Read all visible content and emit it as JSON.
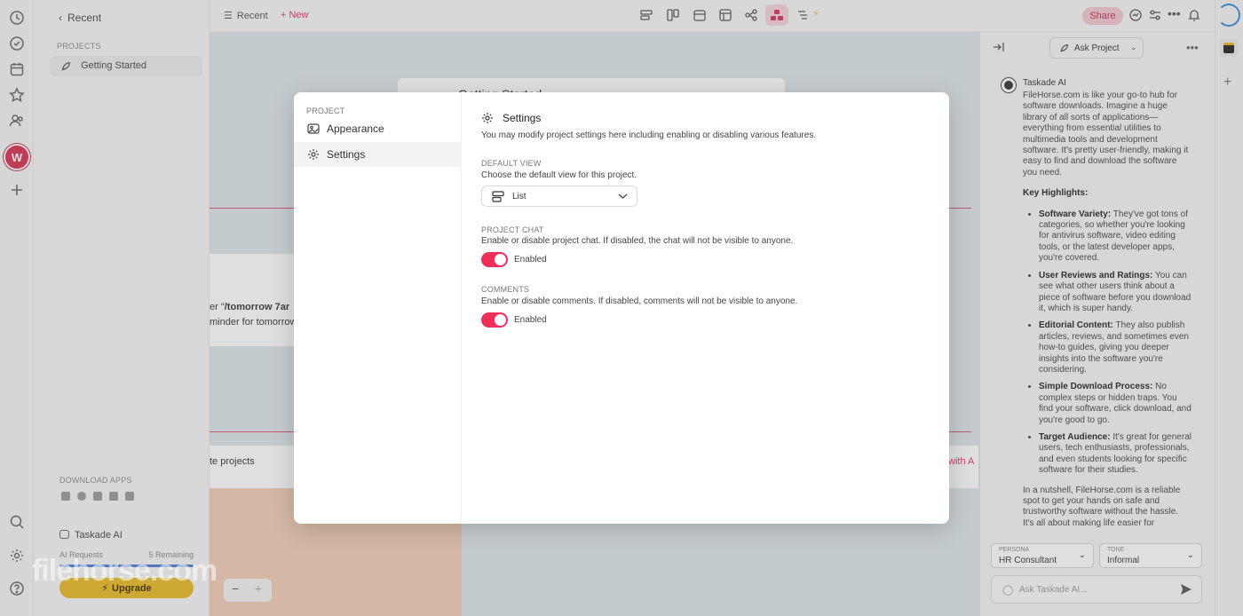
{
  "sidebar": {
    "back_label": "Recent",
    "projects_caption": "PROJECTS",
    "project_item": "Getting Started",
    "download_caption": "DOWNLOAD APPS",
    "ai_label": "Taskade AI",
    "ai_requests_label": "AI Requests",
    "ai_remaining": "5 Remaining",
    "ai_requests_fraction": 1.0,
    "upgrade_label": "Upgrade",
    "workspace_initial": "W"
  },
  "toolbar": {
    "recent_label": "Recent",
    "new_label": "New",
    "share_label": "Share"
  },
  "canvas": {
    "title_fragment": "Getting Started",
    "text_line1_prefix": "er \"",
    "text_line1_bold": "/tomorrow 7ar",
    "text_line2": "minder for tomorrow",
    "row_text": "te projects",
    "row_right_text": "with A"
  },
  "ai_panel": {
    "mode_label": "Ask Project",
    "assistant_name": "Taskade AI",
    "intro": "FileHorse.com is like your go-to hub for software downloads. Imagine a huge library of all sorts of applications—everything from essential utilities to multimedia tools and development software. It's pretty user-friendly, making it easy to find and download the software you need.",
    "highlights_title": "Key Highlights:",
    "highlights": [
      {
        "title": "Software Variety:",
        "text": "They've got tons of categories, so whether you're looking for antivirus software, video editing tools, or the latest developer apps, you're covered."
      },
      {
        "title": "User Reviews and Ratings:",
        "text": "You can see what other users think about a piece of software before you download it, which is super handy."
      },
      {
        "title": "Editorial Content:",
        "text": "They also publish articles, reviews, and sometimes even how-to guides, giving you deeper insights into the software you're considering."
      },
      {
        "title": "Simple Download Process:",
        "text": "No complex steps or hidden traps. You find your software, click download, and you're good to go."
      },
      {
        "title": "Target Audience:",
        "text": "It's great for general users, tech enthusiasts, professionals, and even students looking for specific software for their studies."
      }
    ],
    "conclusion": "In a nutshell, FileHorse.com is a reliable spot to get your hands on safe and trustworthy software without the hassle. It's all about making life easier for",
    "persona_caption": "PERSONA",
    "persona_value": "HR Consultant",
    "tone_caption": "TONE",
    "tone_value": "Informal",
    "ask_placeholder": "Ask Taskade AI..."
  },
  "modal": {
    "nav_caption": "PROJECT",
    "nav_items": [
      "Appearance",
      "Settings"
    ],
    "title": "Settings",
    "description": "You may modify project settings here including enabling or disabling various features.",
    "default_view": {
      "caption": "DEFAULT VIEW",
      "description": "Choose the default view for this project.",
      "value": "List"
    },
    "project_chat": {
      "caption": "PROJECT CHAT",
      "description": "Enable or disable project chat. If disabled, the chat will not be visible to anyone.",
      "state": "Enabled"
    },
    "comments": {
      "caption": "COMMENTS",
      "description": "Enable or disable comments. If disabled, comments will not be visible to anyone.",
      "state": "Enabled"
    }
  },
  "watermark": "filehorse.com",
  "colors": {
    "accent": "#ee2f5c",
    "workspace": "#d5304f",
    "upgrade": "#e8b923",
    "share_bg": "#f4c6cf"
  }
}
